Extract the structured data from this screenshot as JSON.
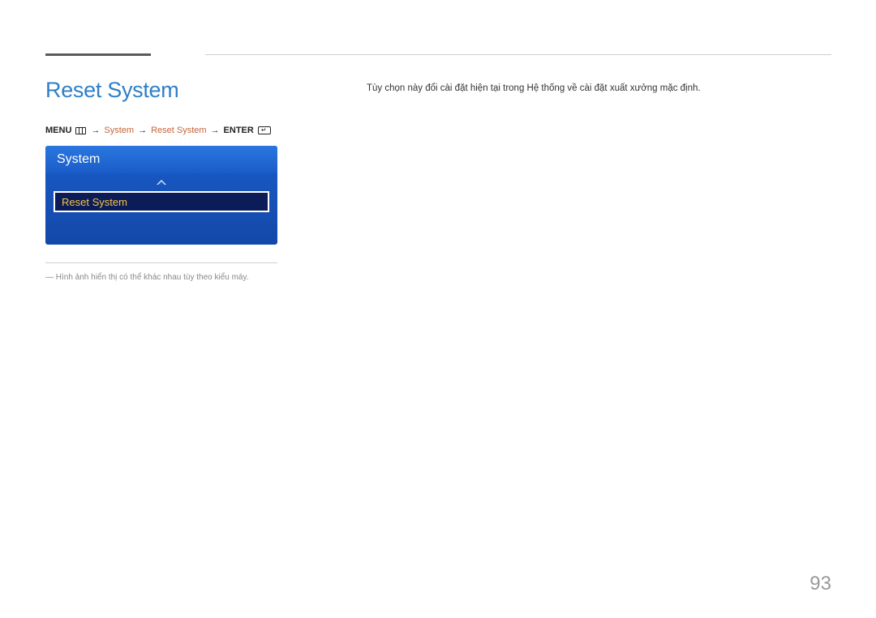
{
  "header": {
    "title": "Reset System"
  },
  "breadcrumb": {
    "menu_label": "MENU",
    "step_system": "System",
    "step_reset": "Reset System",
    "enter_label": "ENTER"
  },
  "osd": {
    "panel_title": "System",
    "selected_item": "Reset System"
  },
  "footnote": "― Hình ảnh hiển thị có thể khác nhau tùy theo kiểu máy.",
  "description": "Tùy chọn này đổi cài đặt hiện tại trong Hệ thống về cài đặt xuất xưởng mặc định.",
  "page_number": "93",
  "icons": {
    "menu": "menu-icon",
    "enter": "enter-icon",
    "chev_up": "chevron-up-icon"
  }
}
